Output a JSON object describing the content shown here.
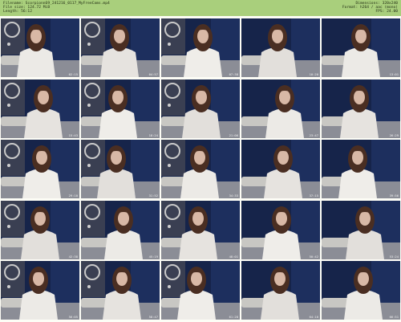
{
  "header": {
    "filename": "Filename: Scorpionn69_241216_0117_MyFreeCams.mp4",
    "filesize": "File size: 124.72 MiB",
    "length": "Length: 56:12",
    "dimensions": "Dimensions: 320x240",
    "format": "Format: h264 / aac (mono)",
    "fps": "FPS: 24.00"
  },
  "thumbnails": [
    {
      "time": "02:15"
    },
    {
      "time": "04:57"
    },
    {
      "time": "07:38"
    },
    {
      "time": "10:20"
    },
    {
      "time": "13:01"
    },
    {
      "time": "15:43"
    },
    {
      "time": "18:24"
    },
    {
      "time": "21:06"
    },
    {
      "time": "23:47"
    },
    {
      "time": "26:29"
    },
    {
      "time": "29:10"
    },
    {
      "time": "31:52"
    },
    {
      "time": "34:33"
    },
    {
      "time": "37:15"
    },
    {
      "time": "39:56"
    },
    {
      "time": "42:38"
    },
    {
      "time": "45:19"
    },
    {
      "time": "48:01"
    },
    {
      "time": "50:42"
    },
    {
      "time": "53:24"
    },
    {
      "time": "56:05"
    },
    {
      "time": "58:47"
    },
    {
      "time": "61:28"
    },
    {
      "time": "64:10"
    },
    {
      "time": "66:51"
    }
  ]
}
